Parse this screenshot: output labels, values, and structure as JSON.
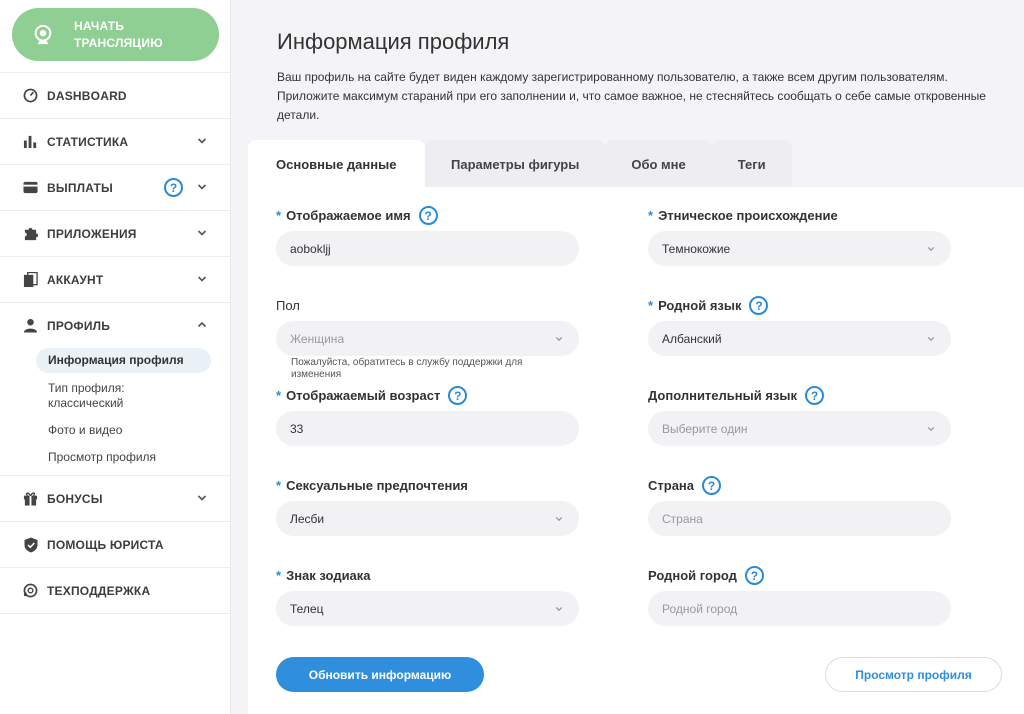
{
  "sidebar": {
    "start_button": {
      "line1": "НАЧАТЬ",
      "line2": "ТРАНСЛЯЦИЮ"
    },
    "items": [
      {
        "label": "DASHBOARD"
      },
      {
        "label": "СТАТИСТИКА"
      },
      {
        "label": "ВЫПЛАТЫ",
        "help": "?"
      },
      {
        "label": "ПРИЛОЖЕНИЯ"
      },
      {
        "label": "АККАУНТ"
      },
      {
        "label": "ПРОФИЛЬ"
      },
      {
        "label": "БОНУСЫ"
      },
      {
        "label": "ПОМОЩЬ ЮРИСТА"
      },
      {
        "label": "ТЕХПОДДЕРЖКА"
      }
    ],
    "profile_sub": [
      {
        "label": "Информация профиля"
      },
      {
        "label": "Тип профиля: классический"
      },
      {
        "label": "Фото и видео"
      },
      {
        "label": "Просмотр профиля"
      }
    ]
  },
  "main": {
    "title": "Информация профиля",
    "description": "Ваш профиль на сайте будет виден каждому зарегистрированному пользователю, а также всем другим пользователям. Приложите максимум стараний при его заполнении и, что самое важное, не стесняйтесь сообщать о себе самые откровенные детали.",
    "tabs": [
      "Основные данные",
      "Параметры фигуры",
      "Обо мне",
      "Теги"
    ],
    "form": {
      "display_name": {
        "label": "Отображаемое имя",
        "value": "aobokljj"
      },
      "gender": {
        "label": "Пол",
        "value": "Женщина",
        "hint": "Пожалуйста, обратитесь в службу поддержки для изменения"
      },
      "age": {
        "label": "Отображаемый возраст",
        "value": "33"
      },
      "sexual_pref": {
        "label": "Сексуальные предпочтения",
        "value": "Лесби"
      },
      "zodiac": {
        "label": "Знак зодиака",
        "value": "Телец"
      },
      "ethnicity": {
        "label": "Этническое происхождение",
        "value": "Темнокожие"
      },
      "native_lang": {
        "label": "Родной язык",
        "value": "Албанский"
      },
      "extra_lang": {
        "label": "Дополнительный язык",
        "placeholder": "Выберите один"
      },
      "country": {
        "label": "Страна",
        "placeholder": "Страна"
      },
      "hometown": {
        "label": "Родной город",
        "placeholder": "Родной город"
      }
    },
    "buttons": {
      "update": "Обновить информацию",
      "preview": "Просмотр профиля"
    }
  },
  "required_mark": "*",
  "help_mark": "?",
  "colors": {
    "accent": "#2f8fdc",
    "start_button": "#8fcf93"
  }
}
